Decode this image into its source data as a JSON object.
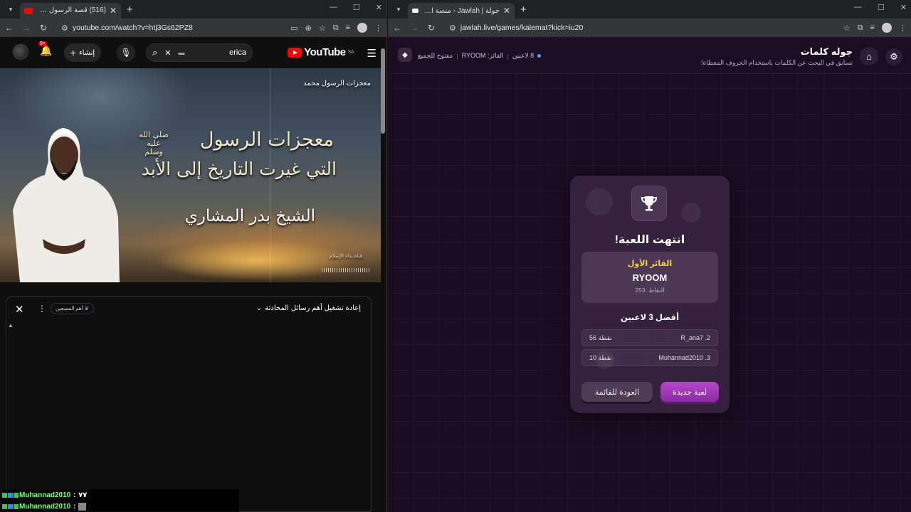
{
  "left_browser": {
    "tab_title": "(516) قصة الرسول ﷺ وحكاية",
    "url": "youtube.com/watch?v=htj3Gs62PZ8",
    "youtube": {
      "logo_text": "YouTube",
      "region": "SA",
      "search_query": "erica",
      "create_label": "إنشاء",
      "notif_badge": "9+"
    },
    "video": {
      "top_caption": "معجزات الرسول محمد",
      "line1": "معجزات الرسول",
      "line1_honorific": "صلى الله عليه وسلم",
      "line2": "التي غيرت التاريخ إلى الأبد",
      "line3": "الشيخ بدر المشاري",
      "channel": "قناة نداء الإسلام"
    },
    "chat": {
      "title": "إعادة تشغيل أهم رسائل المحادثة",
      "chip": "أهم المسجين"
    },
    "overlay": [
      {
        "user": "Muhannad2010",
        "text": "٧٧"
      },
      {
        "user": "Muhannad2010",
        "text": ""
      }
    ]
  },
  "right_browser": {
    "tab_title": "جولة | Jawlah - منصة الألعاب الذ",
    "url": "jawlah.live/games/kalemat?kick=iu20",
    "header": {
      "title": "جوله كلمات",
      "subtitle": "تسابق في البحث عن الكلمات باستخدام الحروف المعطاة!",
      "players": "8 لاعبين",
      "winner": "الفائز: RYOOM",
      "open": "مفتوح للجميع"
    },
    "result": {
      "heading": "انتهت اللعبة!",
      "first_label": "الفائز الأول",
      "first_name": "RYOOM",
      "first_points": "النقاط: 253",
      "top3_heading": "أفضل 3 لاعبين",
      "rows": [
        {
          "name": "R_ana7 .2",
          "points": "56 نقطة"
        },
        {
          "name": "Muhannad2010 .3",
          "points": "10 نقطة"
        }
      ],
      "new_game": "لعبة جديدة",
      "back": "العودة للقائمة"
    }
  },
  "colors": {
    "youtube_red": "#ff0000",
    "accent_purple": "#b548c8",
    "gold": "#f5d13b"
  }
}
